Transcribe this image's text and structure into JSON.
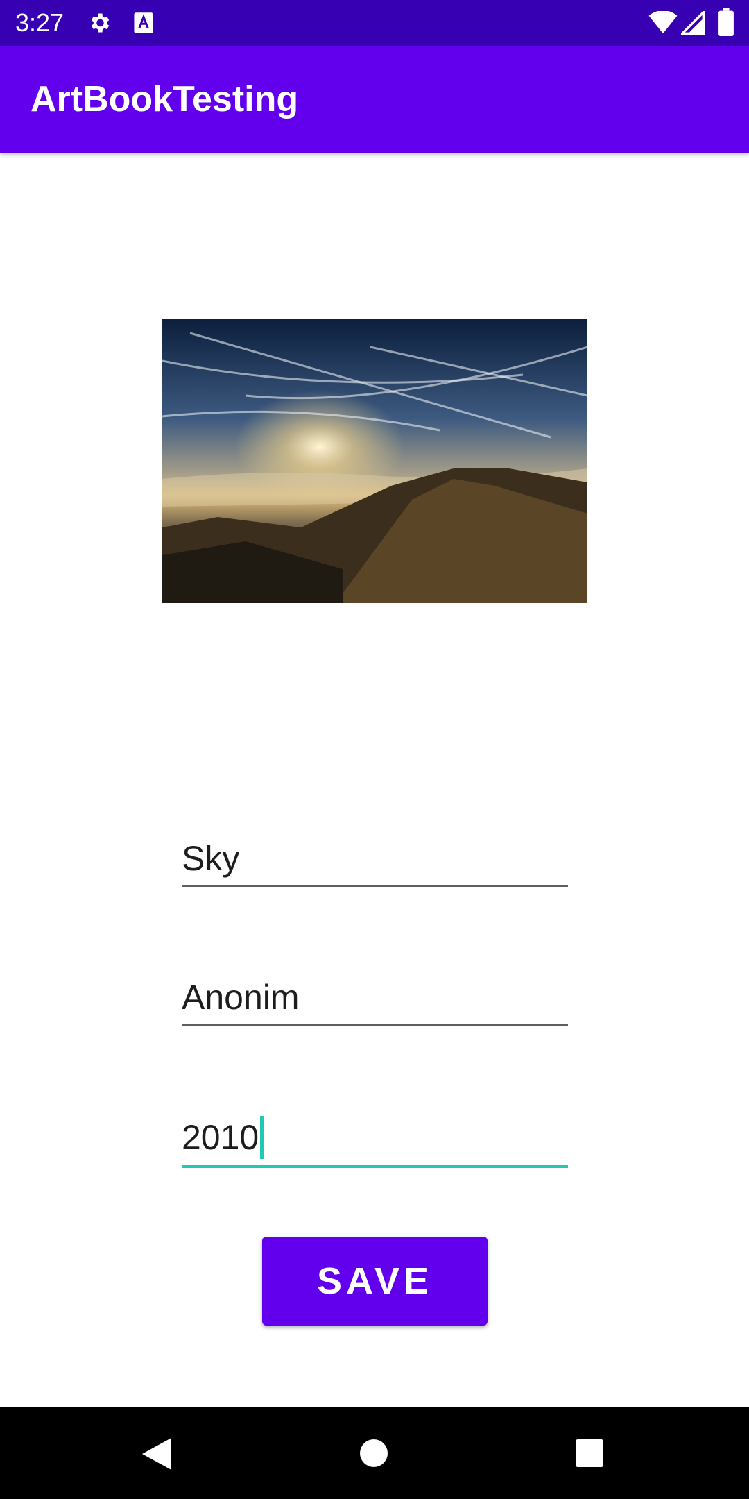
{
  "status_bar": {
    "time": "3:27",
    "icons": [
      "gear-icon",
      "a-icon",
      "wifi-icon",
      "signal-icon",
      "battery-icon"
    ]
  },
  "app_bar": {
    "title": "ArtBookTesting"
  },
  "artwork": {
    "image": "landscape-photo",
    "description_icon": "sky-over-mountain-image"
  },
  "form": {
    "name_value": "Sky",
    "artist_value": "Anonim",
    "year_value": "2010"
  },
  "save_button": {
    "label": "SAVE"
  },
  "nav_bar": {
    "icons": [
      "back-icon",
      "home-icon",
      "recents-icon"
    ]
  },
  "colors": {
    "status_bar": "#3700b3",
    "primary": "#6200ee",
    "focus_accent": "#1fc9b2"
  }
}
